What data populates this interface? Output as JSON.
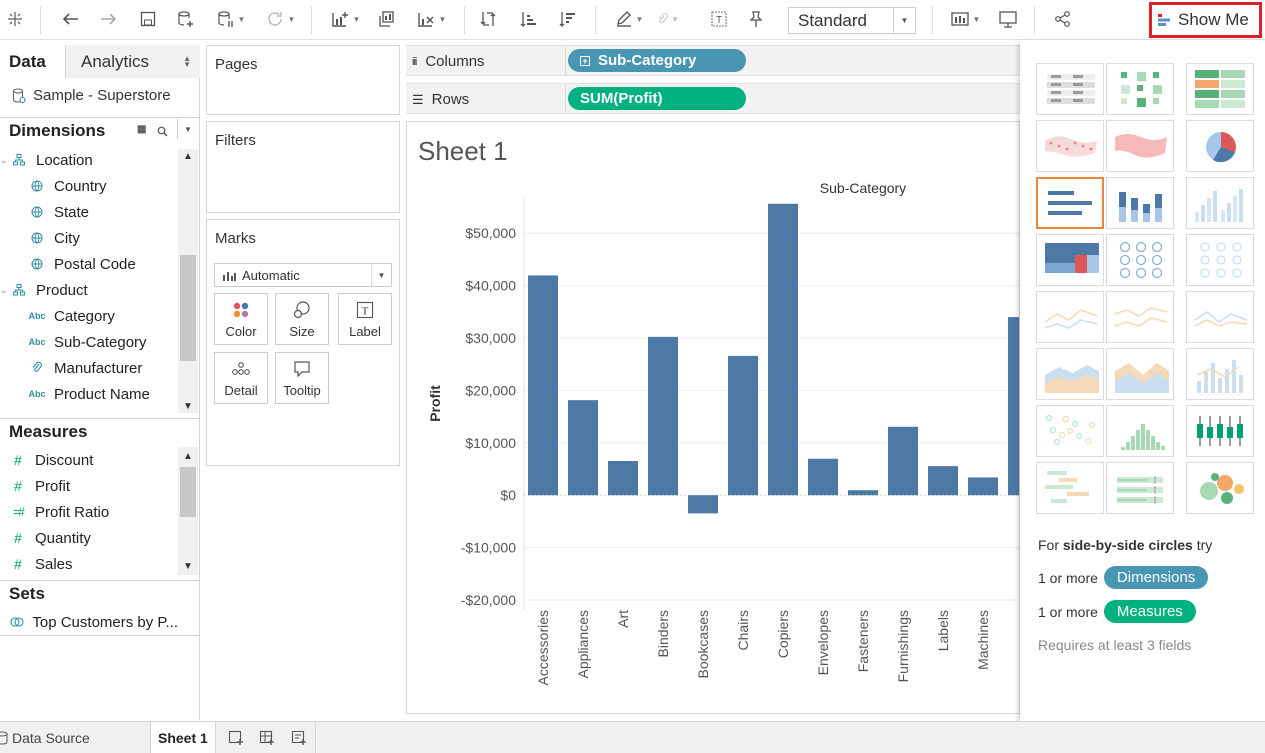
{
  "toolbar": {
    "view_mode": "Standard",
    "show_me_label": "Show Me"
  },
  "data_pane": {
    "tabs": {
      "data": "Data",
      "analytics": "Analytics"
    },
    "datasource": "Sample - Superstore",
    "dimensions_header": "Dimensions",
    "dimensions": [
      {
        "label": "Location",
        "icon": "hierarchy-icon",
        "indent": 0
      },
      {
        "label": "Country",
        "icon": "globe-icon",
        "indent": 1
      },
      {
        "label": "State",
        "icon": "globe-icon",
        "indent": 1
      },
      {
        "label": "City",
        "icon": "globe-icon",
        "indent": 1
      },
      {
        "label": "Postal Code",
        "icon": "globe-icon",
        "indent": 1
      },
      {
        "label": "Product",
        "icon": "hierarchy-icon",
        "indent": 0
      },
      {
        "label": "Category",
        "icon": "abc-icon",
        "indent": 1
      },
      {
        "label": "Sub-Category",
        "icon": "abc-icon",
        "indent": 1
      },
      {
        "label": "Manufacturer",
        "icon": "paperclip-icon",
        "indent": 1
      },
      {
        "label": "Product Name",
        "icon": "abc-icon",
        "indent": 1
      }
    ],
    "measures_header": "Measures",
    "measures": [
      {
        "label": "Discount",
        "icon": "hash-icon"
      },
      {
        "label": "Profit",
        "icon": "hash-icon"
      },
      {
        "label": "Profit Ratio",
        "icon": "calc-hash-icon"
      },
      {
        "label": "Quantity",
        "icon": "hash-icon"
      },
      {
        "label": "Sales",
        "icon": "hash-icon"
      }
    ],
    "sets_header": "Sets",
    "sets": [
      {
        "label": "Top Customers by P...",
        "icon": "set-icon"
      }
    ]
  },
  "cards": {
    "pages": "Pages",
    "filters": "Filters",
    "marks": "Marks",
    "marks_type": "Automatic",
    "mark_buttons": [
      "Color",
      "Size",
      "Label",
      "Detail",
      "Tooltip"
    ]
  },
  "shelves": {
    "columns_label": "Columns",
    "columns_pill": "Sub-Category",
    "rows_label": "Rows",
    "rows_pill": "SUM(Profit)"
  },
  "sheet_title": "Sheet 1",
  "colors": {
    "bar": "#4e79a7",
    "dimension_pill": "#4996b2",
    "measure_pill": "#00b180",
    "highlight": "#e0202a"
  },
  "chart_data": {
    "type": "bar",
    "title": "Sub-Category",
    "xlabel": "",
    "ylabel": "Profit",
    "ylim": [
      -20000,
      55000
    ],
    "yticks": [
      -20000,
      -10000,
      0,
      10000,
      20000,
      30000,
      40000,
      50000
    ],
    "ytick_labels": [
      "-$20,000",
      "-$10,000",
      "$0",
      "$10,000",
      "$20,000",
      "$30,000",
      "$40,000",
      "$50,000"
    ],
    "categories": [
      "Accessories",
      "Appliances",
      "Art",
      "Binders",
      "Bookcases",
      "Chairs",
      "Copiers",
      "Envelopes",
      "Fasteners",
      "Furnishings",
      "Labels",
      "Machines"
    ],
    "values": [
      41937,
      18138,
      6528,
      30222,
      -3473,
      26590,
      55618,
      6964,
      950,
      13059,
      5546,
      3385
    ],
    "partial_next_value": 34000,
    "grid": true,
    "legend": "none"
  },
  "show_me": {
    "hint_prefix": "For",
    "hint_chart": "side-by-side circles",
    "hint_suffix": "try",
    "req1_prefix": "1 or more",
    "req1_pill": "Dimensions",
    "req2_prefix": "1 or more",
    "req2_pill": "Measures",
    "footer": "Requires at least 3 fields",
    "selected_index": 6
  },
  "bottom": {
    "data_source": "Data Source",
    "sheet_tab": "Sheet 1"
  }
}
